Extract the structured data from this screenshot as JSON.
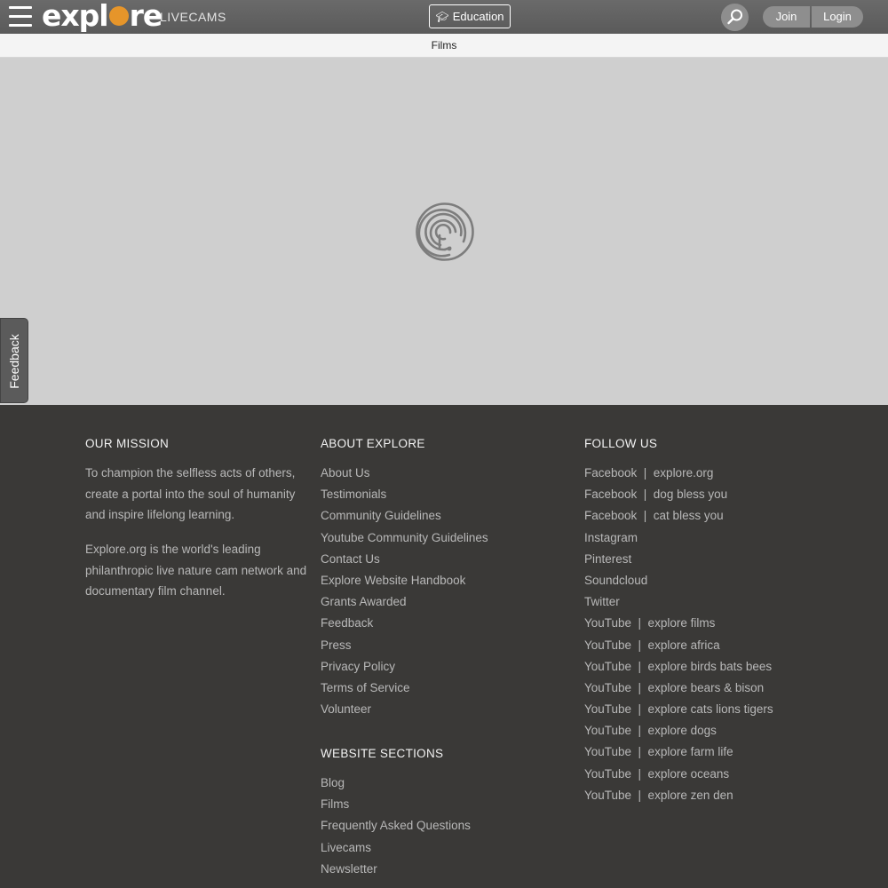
{
  "header": {
    "logo_text_before": "expl",
    "logo_text_after": "re",
    "livecams_label": "LIVECAMS",
    "education_label": "Education",
    "join_label": "Join",
    "login_label": "Login"
  },
  "subnav": {
    "films_label": "Films"
  },
  "feedback_label": "Feedback",
  "footer": {
    "mission": {
      "heading": "OUR MISSION",
      "para1": "To champion the selfless acts of others, create a portal into the soul of humanity and inspire lifelong learning.",
      "para2": "Explore.org is the world's leading philanthropic live nature cam network and documentary film channel."
    },
    "about": {
      "heading": "ABOUT EXPLORE",
      "links": [
        "About Us",
        "Testimonials",
        "Community Guidelines",
        "Youtube Community Guidelines",
        "Contact Us",
        "Explore Website Handbook",
        "Grants Awarded",
        "Feedback",
        "Press",
        "Privacy Policy",
        "Terms of Service",
        "Volunteer"
      ]
    },
    "sections": {
      "heading": "WEBSITE SECTIONS",
      "links": [
        "Blog",
        "Films",
        "Frequently Asked Questions",
        "Livecams",
        "Newsletter"
      ]
    },
    "follow": {
      "heading": "FOLLOW US",
      "links": [
        "Facebook  |  explore.org",
        "Facebook  |  dog bless you",
        "Facebook  |  cat bless you",
        "Instagram",
        "Pinterest",
        "Soundcloud",
        "Twitter",
        "YouTube  |  explore films",
        "YouTube  |  explore africa",
        "YouTube  |  explore birds bats bees",
        "YouTube  |  explore bears & bison",
        "YouTube  |  explore cats lions tigers",
        "YouTube  |  explore dogs",
        "YouTube  |  explore farm life",
        "YouTube  |  explore oceans",
        "YouTube  |  explore zen den"
      ]
    }
  },
  "colors": {
    "accent": "#e6952a",
    "header_bg": "#5f5f5f",
    "footer_bg": "#3a3937"
  }
}
